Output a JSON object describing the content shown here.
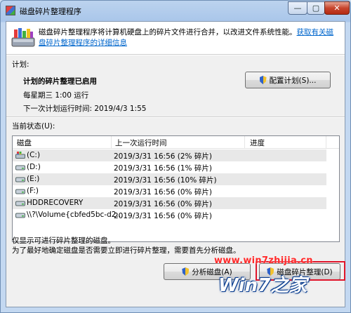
{
  "window": {
    "title": "磁盘碎片整理程序",
    "controls": {
      "minimize": "—",
      "maximize": "▢",
      "close": "✕"
    }
  },
  "intro": {
    "text": "磁盘碎片整理程序将计算机硬盘上的碎片文件进行合并，以改进文件系统性能。",
    "link": "获取有关磁盘碎片整理程序的详细信息"
  },
  "schedule": {
    "section_label": "计划:",
    "status": "计划的碎片整理已启用",
    "frequency": "每星期三 1:00 运行",
    "next_run": "下一次计划运行时间: 2019/4/3 1:55",
    "configure_button": "配置计划(S)..."
  },
  "current_status": {
    "section_label": "当前状态(U):",
    "columns": [
      "磁盘",
      "上一次运行时间",
      "进度"
    ],
    "rows": [
      {
        "name": "(C:)",
        "last_run": "2019/3/31 16:56 (2% 碎片)",
        "icon": "system-drive-icon"
      },
      {
        "name": "(D:)",
        "last_run": "2019/3/31 16:56 (1% 碎片)",
        "icon": "drive-icon"
      },
      {
        "name": "(E:)",
        "last_run": "2019/3/31 16:56 (10% 碎片)",
        "icon": "drive-icon"
      },
      {
        "name": "(F:)",
        "last_run": "2019/3/31 16:56 (0% 碎片)",
        "icon": "drive-icon"
      },
      {
        "name": "HDDRECOVERY",
        "last_run": "2019/3/31 16:56 (0% 碎片)",
        "icon": "drive-icon"
      },
      {
        "name": "\\\\?\\Volume{cbfed5bc-d2...",
        "last_run": "2019/3/31 16:56 (0% 碎片)",
        "icon": "drive-icon"
      }
    ]
  },
  "footer": {
    "note1": "仅显示可进行碎片整理的磁盘。",
    "note2": "为了最好地确定磁盘是否需要立即进行碎片整理，需要首先分析磁盘。",
    "analyze_button": "分析磁盘(A)",
    "defrag_button": "磁盘碎片整理(D)"
  },
  "watermark": {
    "url": "www.win7zhijia.cn",
    "logo": "Win7之家"
  },
  "colors": {
    "link": "#0066cc",
    "highlight_box": "#e0162b",
    "watermark_red": "#ff2a2a"
  }
}
